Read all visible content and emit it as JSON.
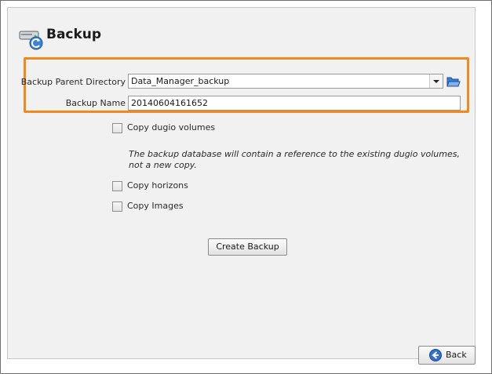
{
  "header": {
    "title": "Backup",
    "icon": "backup-drive-icon"
  },
  "form": {
    "parent_directory_label": "Backup Parent Directory",
    "parent_directory_value": "Data_Manager_backup",
    "browse_icon": "folder-open-icon",
    "backup_name_label": "Backup Name",
    "backup_name_value": "20140604161652"
  },
  "options": {
    "copy_dugio": {
      "label": "Copy dugio volumes",
      "checked": false
    },
    "note": "The backup database will contain a reference to the existing dugio volumes, not a new copy.",
    "copy_horizons": {
      "label": "Copy horizons",
      "checked": false
    },
    "copy_images": {
      "label": "Copy Images",
      "checked": false
    }
  },
  "actions": {
    "create_label": "Create Backup",
    "back_label": "Back"
  },
  "colors": {
    "highlight": "#f08a1c",
    "back_icon": "#2f6fd1"
  }
}
